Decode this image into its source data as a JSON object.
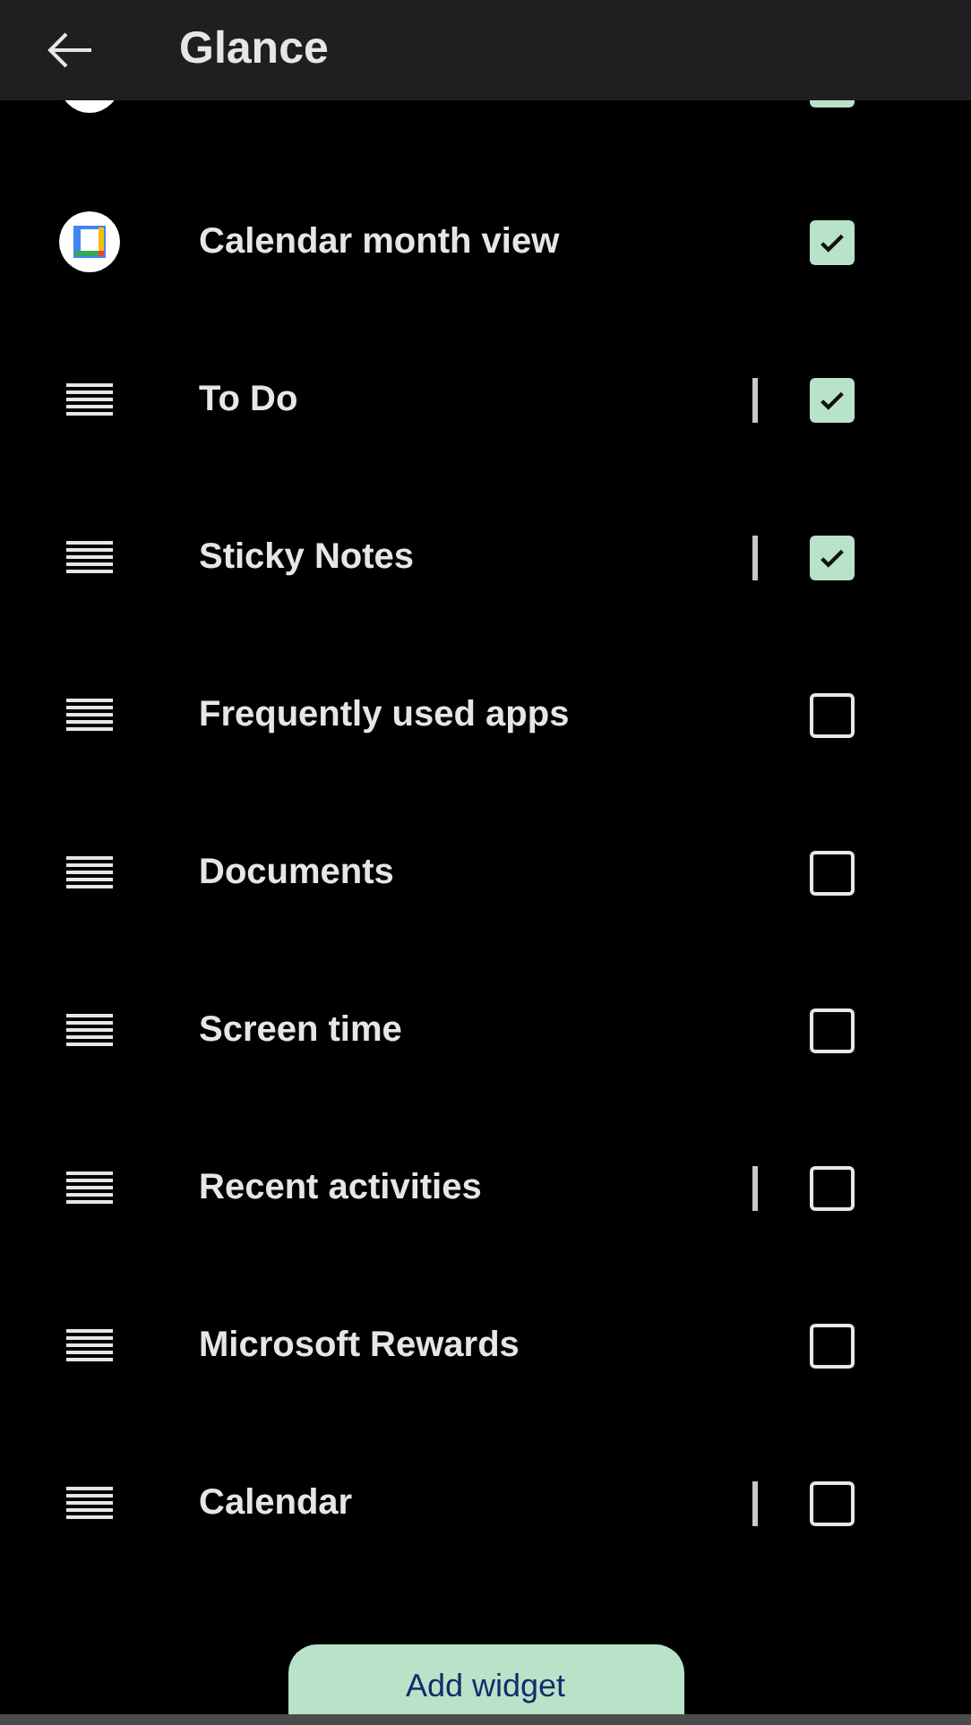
{
  "header": {
    "title": "Glance"
  },
  "items": [
    {
      "kind": "app",
      "checked": true,
      "separator": false
    },
    {
      "kind": "calendar",
      "label": "Calendar month view",
      "checked": true,
      "separator": false
    },
    {
      "kind": "drag",
      "label": "To Do",
      "checked": true,
      "separator": true
    },
    {
      "kind": "drag",
      "label": "Sticky Notes",
      "checked": true,
      "separator": true
    },
    {
      "kind": "drag",
      "label": "Frequently used apps",
      "checked": false,
      "separator": false
    },
    {
      "kind": "drag",
      "label": "Documents",
      "checked": false,
      "separator": false
    },
    {
      "kind": "drag",
      "label": "Screen time",
      "checked": false,
      "separator": false
    },
    {
      "kind": "drag",
      "label": "Recent activities",
      "checked": false,
      "separator": true
    },
    {
      "kind": "drag",
      "label": "Microsoft Rewards",
      "checked": false,
      "separator": false
    },
    {
      "kind": "drag",
      "label": "Calendar",
      "checked": false,
      "separator": true
    }
  ],
  "add_button": {
    "label": "Add widget"
  }
}
